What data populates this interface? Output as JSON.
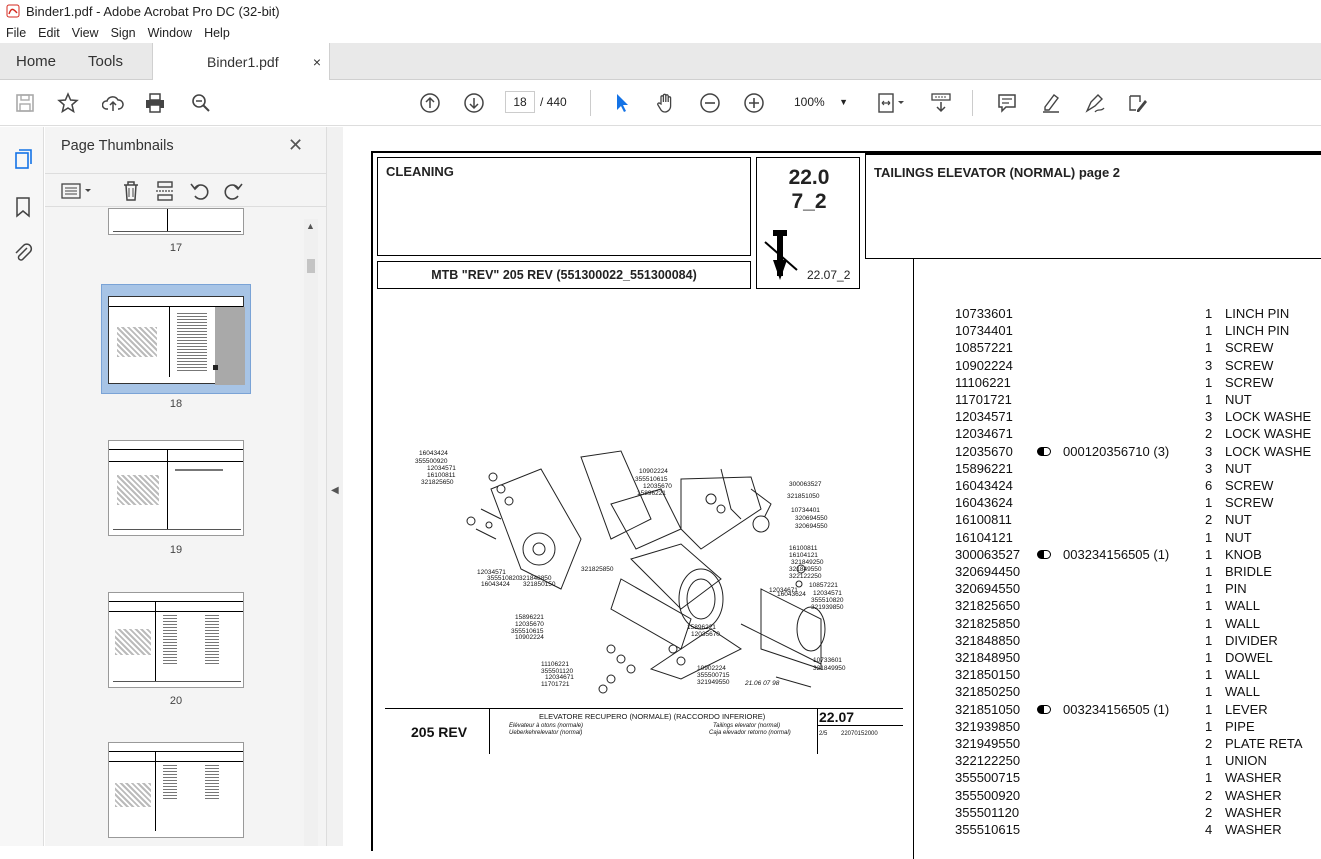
{
  "app": {
    "window_title": "Binder1.pdf - Adobe Acrobat Pro DC (32-bit)",
    "menu": [
      "File",
      "Edit",
      "View",
      "Sign",
      "Window",
      "Help"
    ],
    "tabs": {
      "home": "Home",
      "tools": "Tools",
      "document": "Binder1.pdf",
      "close": "×"
    },
    "toolbar": {
      "current_page": "18",
      "total_pages": "/ 440",
      "zoom": "100%"
    }
  },
  "panel": {
    "title": "Page Thumbnails",
    "thumbnails": [
      "17",
      "18",
      "19",
      "20"
    ]
  },
  "document": {
    "header_left": "CLEANING",
    "header_code": "22.0\n7_2",
    "header_right": "TAILINGS ELEVATOR (NORMAL)  page 2",
    "model": "MTB \"REV\" 205 REV (551300022_551300084)",
    "small_code": "22.07_2",
    "footer_model": "205 REV",
    "footer_title": "ELEVATORE RECUPERO  (NORMALE) (RACCORDO INFERIORE)",
    "footer_sub1": "Elévateur à otons (normale)",
    "footer_sub2": "Ueberkehrelevator (normal)",
    "footer_sub3": "Tailings elevator (normal)",
    "footer_sub4": "Caja elevador retorno (normal)",
    "footer_code": "22.07",
    "footer_page": "2/5",
    "footer_ref": "22070152000",
    "diagram_date": "21.06  07  98",
    "diagram_labels": [
      "16043424",
      "355500920",
      "12034571",
      "16100811",
      "321825650",
      "10902224",
      "355510615",
      "12035670",
      "15896221",
      "300063527",
      "321851050",
      "10734401",
      "320694550",
      "320694550",
      "16100811",
      "16104121",
      "321849250",
      "321849550",
      "322122250",
      "321848850",
      "321850150",
      "321825850",
      "12034571",
      "355510820",
      "16043424",
      "10857221",
      "12034671",
      "16043624",
      "12034571",
      "355510820",
      "321939850",
      "15896221",
      "12035670",
      "355510615",
      "10902224",
      "15896221",
      "12035670",
      "11106221",
      "355501120",
      "12034671",
      "11701721",
      "10902224",
      "355500715",
      "321949550",
      "10733601",
      "321849950"
    ],
    "parts": [
      {
        "code": "10733601",
        "ref": "",
        "qty": "1",
        "desc": "LINCH PIN"
      },
      {
        "code": "10734401",
        "ref": "",
        "qty": "1",
        "desc": "LINCH PIN"
      },
      {
        "code": "10857221",
        "ref": "",
        "qty": "1",
        "desc": "SCREW"
      },
      {
        "code": "10902224",
        "ref": "",
        "qty": "3",
        "desc": "SCREW"
      },
      {
        "code": "11106221",
        "ref": "",
        "qty": "1",
        "desc": "SCREW"
      },
      {
        "code": "11701721",
        "ref": "",
        "qty": "1",
        "desc": "NUT"
      },
      {
        "code": "12034571",
        "ref": "",
        "qty": "3",
        "desc": "LOCK WASHE"
      },
      {
        "code": "12034671",
        "ref": "",
        "qty": "2",
        "desc": "LOCK WASHE"
      },
      {
        "code": "12035670",
        "ref": "000120356710  (3)",
        "qty": "3",
        "desc": "LOCK WASHE"
      },
      {
        "code": "15896221",
        "ref": "",
        "qty": "3",
        "desc": "NUT"
      },
      {
        "code": "16043424",
        "ref": "",
        "qty": "6",
        "desc": "SCREW"
      },
      {
        "code": "16043624",
        "ref": "",
        "qty": "1",
        "desc": "SCREW"
      },
      {
        "code": "16100811",
        "ref": "",
        "qty": "2",
        "desc": "NUT"
      },
      {
        "code": "16104121",
        "ref": "",
        "qty": "1",
        "desc": "NUT"
      },
      {
        "code": "300063527",
        "ref": "003234156505  (1)",
        "qty": "1",
        "desc": "KNOB"
      },
      {
        "code": "320694450",
        "ref": "",
        "qty": "1",
        "desc": "BRIDLE"
      },
      {
        "code": "320694550",
        "ref": "",
        "qty": "1",
        "desc": "PIN"
      },
      {
        "code": "321825650",
        "ref": "",
        "qty": "1",
        "desc": "WALL"
      },
      {
        "code": "321825850",
        "ref": "",
        "qty": "1",
        "desc": "WALL"
      },
      {
        "code": "321848850",
        "ref": "",
        "qty": "1",
        "desc": "DIVIDER"
      },
      {
        "code": "321848950",
        "ref": "",
        "qty": "1",
        "desc": "DOWEL"
      },
      {
        "code": "321850150",
        "ref": "",
        "qty": "1",
        "desc": "WALL"
      },
      {
        "code": "321850250",
        "ref": "",
        "qty": "1",
        "desc": "WALL"
      },
      {
        "code": "321851050",
        "ref": "003234156505  (1)",
        "qty": "1",
        "desc": "LEVER"
      },
      {
        "code": "321939850",
        "ref": "",
        "qty": "1",
        "desc": "PIPE"
      },
      {
        "code": "321949550",
        "ref": "",
        "qty": "2",
        "desc": "PLATE RETA"
      },
      {
        "code": "322122250",
        "ref": "",
        "qty": "1",
        "desc": "UNION"
      },
      {
        "code": "355500715",
        "ref": "",
        "qty": "1",
        "desc": "WASHER"
      },
      {
        "code": "355500920",
        "ref": "",
        "qty": "2",
        "desc": "WASHER"
      },
      {
        "code": "355501120",
        "ref": "",
        "qty": "2",
        "desc": "WASHER"
      },
      {
        "code": "355510615",
        "ref": "",
        "qty": "4",
        "desc": "WASHER"
      }
    ]
  }
}
